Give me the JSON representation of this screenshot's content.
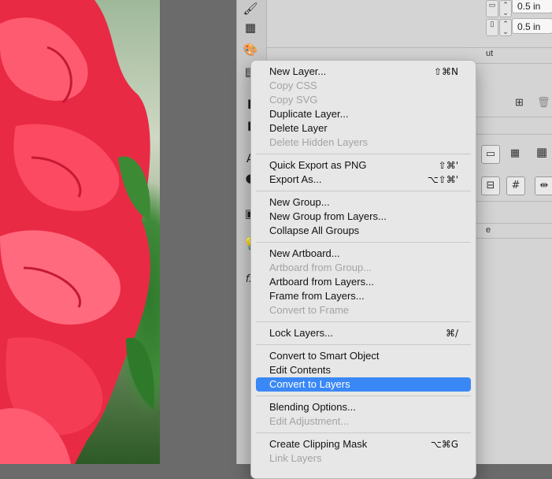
{
  "toolbar": {
    "tools": [
      "brush-icon",
      "grid-icon",
      "palette-icon",
      "table-icon",
      "document-icon",
      "document-icon",
      "text-icon",
      "dot-icon",
      "frame-icon",
      "lightbulb-icon",
      "fx-icon"
    ],
    "labels": {
      "text": "A",
      "fx": "fx"
    }
  },
  "panel": {
    "width_value": "0.5 in",
    "height_value": "0.5 in",
    "partial_label_1": "ut",
    "partial_label_2": "e"
  },
  "menu": {
    "highlight_color": "#3a88f5",
    "groups": [
      [
        {
          "label": "New Layer...",
          "shortcut": "⇧⌘N",
          "enabled": true
        },
        {
          "label": "Copy CSS",
          "shortcut": "",
          "enabled": false
        },
        {
          "label": "Copy SVG",
          "shortcut": "",
          "enabled": false
        },
        {
          "label": "Duplicate Layer...",
          "shortcut": "",
          "enabled": true
        },
        {
          "label": "Delete Layer",
          "shortcut": "",
          "enabled": true
        },
        {
          "label": "Delete Hidden Layers",
          "shortcut": "",
          "enabled": false
        }
      ],
      [
        {
          "label": "Quick Export as PNG",
          "shortcut": "⇧⌘'",
          "enabled": true
        },
        {
          "label": "Export As...",
          "shortcut": "⌥⇧⌘'",
          "enabled": true
        }
      ],
      [
        {
          "label": "New Group...",
          "shortcut": "",
          "enabled": true
        },
        {
          "label": "New Group from Layers...",
          "shortcut": "",
          "enabled": true
        },
        {
          "label": "Collapse All Groups",
          "shortcut": "",
          "enabled": true
        }
      ],
      [
        {
          "label": "New Artboard...",
          "shortcut": "",
          "enabled": true
        },
        {
          "label": "Artboard from Group...",
          "shortcut": "",
          "enabled": false
        },
        {
          "label": "Artboard from Layers...",
          "shortcut": "",
          "enabled": true
        },
        {
          "label": "Frame from Layers...",
          "shortcut": "",
          "enabled": true
        },
        {
          "label": "Convert to Frame",
          "shortcut": "",
          "enabled": false
        }
      ],
      [
        {
          "label": "Lock Layers...",
          "shortcut": "⌘/",
          "enabled": true
        }
      ],
      [
        {
          "label": "Convert to Smart Object",
          "shortcut": "",
          "enabled": true
        },
        {
          "label": "Edit Contents",
          "shortcut": "",
          "enabled": true
        },
        {
          "label": "Convert to Layers",
          "shortcut": "",
          "enabled": true,
          "selected": true
        }
      ],
      [
        {
          "label": "Blending Options...",
          "shortcut": "",
          "enabled": true
        },
        {
          "label": "Edit Adjustment...",
          "shortcut": "",
          "enabled": false
        }
      ],
      [
        {
          "label": "Create Clipping Mask",
          "shortcut": "⌥⌘G",
          "enabled": true
        },
        {
          "label": "Link Layers",
          "shortcut": "",
          "enabled": false
        }
      ]
    ]
  }
}
